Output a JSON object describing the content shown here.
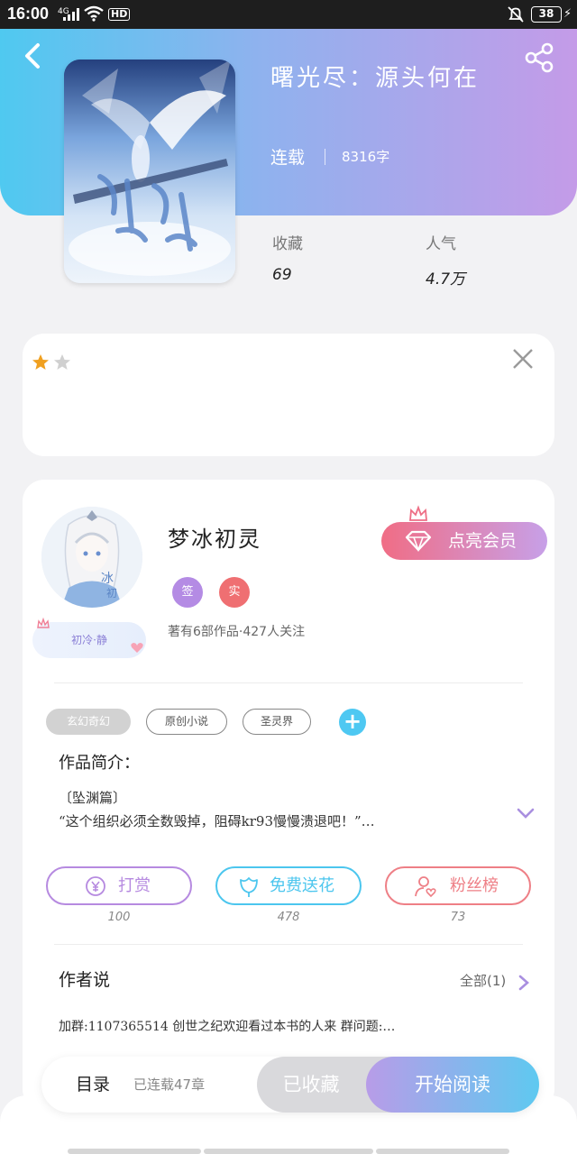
{
  "status_bar": {
    "time": "16:00",
    "network": "4G",
    "hd": "HD",
    "battery": "38"
  },
  "book": {
    "title": "曙光尽：源头何在",
    "status": "连载",
    "word_count": "8316字",
    "stats": [
      {
        "label": "收藏",
        "value": "69"
      },
      {
        "label": "人气",
        "value": "4.7万"
      }
    ]
  },
  "rating": {
    "value": 1,
    "max": 2
  },
  "author": {
    "name": "梦冰初灵",
    "badges": [
      "签",
      "实"
    ],
    "meta": "著有6部作品·427人关注",
    "frame_label": "初冷·静",
    "member_button": "点亮会员"
  },
  "tags": [
    "玄幻奇幻",
    "原创小说",
    "圣灵界"
  ],
  "tag_add": "+",
  "intro": {
    "heading": "作品简介：",
    "line1": "〔坠渊篇〕",
    "line2": "“这个组织必须全数毁掉，阻碍kr93慢慢溃退吧！”…"
  },
  "actions": [
    {
      "label": "打赏",
      "count": "100",
      "color": "#b68ae0"
    },
    {
      "label": "免费送花",
      "count": "478",
      "color": "#4cc6ee"
    },
    {
      "label": "粉丝榜",
      "count": "73",
      "color": "#ee7f86"
    }
  ],
  "author_says": {
    "title": "作者说",
    "all": "全部(1)",
    "text": "加群:1107365514 创世之纪欢迎看过本书的人来 群问题:…"
  },
  "bottom_bar": {
    "toc": "目录",
    "toc_meta": "已连载47章",
    "collected": "已收藏",
    "read": "开始阅读"
  }
}
